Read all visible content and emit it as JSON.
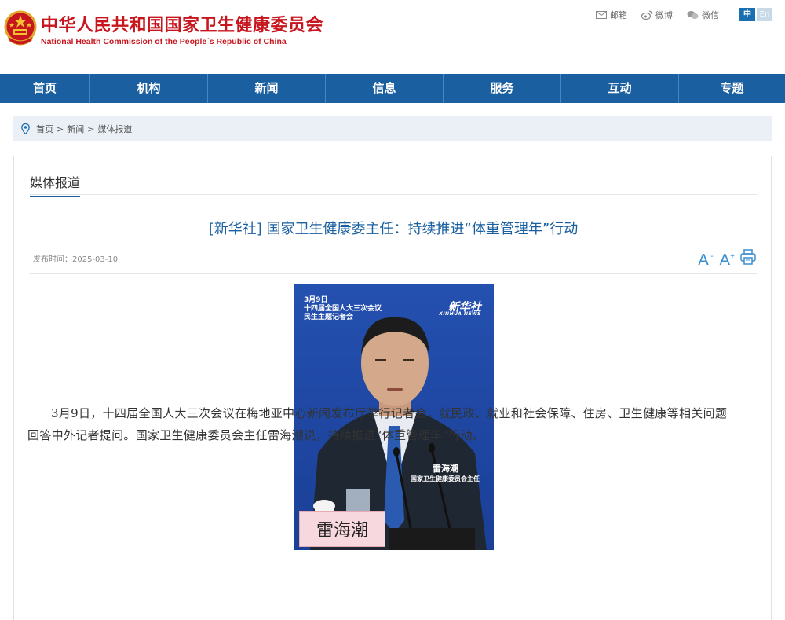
{
  "header": {
    "title_cn": "中华人民共和国国家卫生健康委员会",
    "title_en": "National Health Commission of the People´s Republic of China",
    "tools": [
      {
        "icon": "mail-icon",
        "label": "邮箱"
      },
      {
        "icon": "weibo-icon",
        "label": "微博"
      },
      {
        "icon": "wechat-icon",
        "label": "微信"
      }
    ],
    "lang_cn": "中",
    "lang_en": "En"
  },
  "nav": [
    "首页",
    "机构",
    "新闻",
    "信息",
    "服务",
    "互动",
    "专题"
  ],
  "breadcrumb": {
    "home": "首页",
    "news": "新闻",
    "current": "媒体报道",
    "separator": ">"
  },
  "section": {
    "tab": "媒体报道"
  },
  "article": {
    "title": "[新华社] 国家卫生健康委主任：持续推进“体重管理年”行动",
    "date_label": "发布时间：",
    "date": "2025-03-10",
    "font_decrease": "A",
    "font_increase": "A",
    "font_increase_sup": "+",
    "body": "3月9日，十四届全国人大三次会议在梅地亚中心新闻发布厅举行记者会，就民政、就业和社会保障、住房、卫生健康等相关问题回答中外记者提问。国家卫生健康委员会主任雷海潮说，持续推进“体重管理年”行动。"
  },
  "media": {
    "date_line1": "3月9日",
    "date_line2": "十四届全国人大三次会议",
    "date_line3": "民生主题记者会",
    "logo_cn": "新华社",
    "logo_en": "XINHUA NEWS",
    "speaker_name": "雷海潮",
    "speaker_role": "国家卫生健康委员会主任",
    "nameplate": "雷海潮"
  },
  "colors": {
    "brand_red": "#c8161e",
    "nav_blue": "#1a5fa0",
    "title_blue": "#1a5fa0",
    "crumb_bg": "#eaf0f6"
  }
}
